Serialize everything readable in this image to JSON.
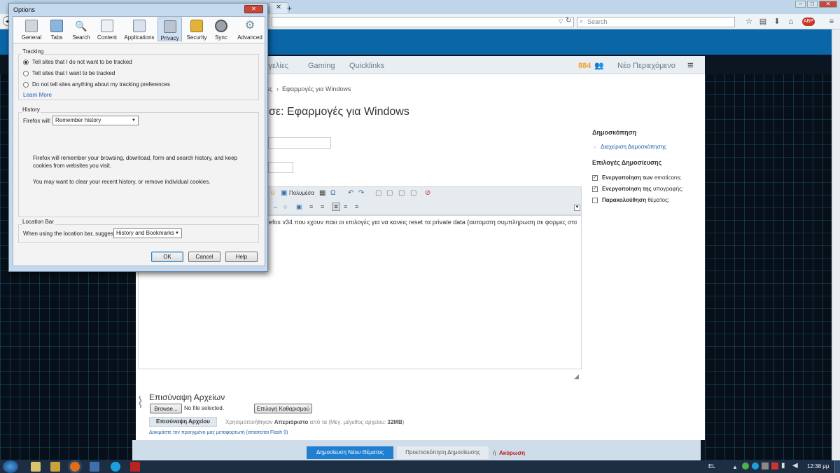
{
  "dialog": {
    "title": "Options",
    "tabs": [
      "General",
      "Tabs",
      "Search",
      "Content",
      "Applications",
      "Privacy",
      "Security",
      "Sync",
      "Advanced"
    ],
    "active_tab": "Privacy",
    "tracking": {
      "heading": "Tracking",
      "opt1": "Tell sites that I do not want to be tracked",
      "opt2": "Tell sites that I want to be tracked",
      "opt3": "Do not tell sites anything about my tracking preferences",
      "learn_more": "Learn More"
    },
    "history": {
      "heading": "History",
      "will_label": "Firefox will:",
      "select_value": "Remember history",
      "desc1": "Firefox will remember your browsing, download, form and search history, and keep cookies from websites you visit.",
      "desc2": "You may want to clear your recent history, or remove individual cookies."
    },
    "locationbar": {
      "heading": "Location Bar",
      "label": "When using the location bar, suggest:",
      "select_value": "History and Bookmarks"
    },
    "buttons": {
      "ok": "OK",
      "cancel": "Cancel",
      "help": "Help"
    }
  },
  "browser": {
    "search_placeholder": "Search"
  },
  "site": {
    "nav": [
      "γγελίες",
      "Gaming",
      "Quicklinks"
    ],
    "online_count": "884",
    "new_content": "Νέο Περιεχόμενο",
    "breadcrumb_partial": "ες",
    "breadcrumb_current": "Εφαρμογές για Windows",
    "page_title": "σε: Εφαρμογές για Windows",
    "toolbar_label": "Πολυμέσα",
    "editor_text": "efox v34 που εχουν παει οι επιλογές για να κανεις reset τα private data (αυτοματη συμπληρωση σε φορμες στο",
    "right": {
      "poll_heading": "Δημοσκόπηση",
      "poll_link": "Διαχείριση Δημοσκόπησης",
      "options_heading": "Επιλογές Δημοσίευσης",
      "opt1_bold": "Ενεργοποίηση των",
      "opt1_rest": "emoticons;",
      "opt2_bold": "Ενεργοποίηση της",
      "opt2_rest": "υπογραφής;",
      "opt3_bold": "Παρακολούθηση",
      "opt3_rest": "θέματος;"
    },
    "attach": {
      "heading": "Επισύναψη Αρχείων",
      "browse": "Browse...",
      "no_file": "No file selected.",
      "choose_clear": "Επιλογή Καθαρισμού",
      "attach_btn": "Επισύναψη Αρχείου",
      "used_text": "Χρησιμοποιήθηκαν",
      "used_bold": "Απεριόριστο",
      "used_mid": "από τα (Μεγ. μέγεθος αρχείου:",
      "used_size": "32MB",
      "used_end": ")",
      "prev_uploader": "Δοκιμάστε τον προηγμένο μας μεταφορτωτή (απαιτείται Flash 9)"
    },
    "footer": {
      "submit": "Δημοσίευση Νέου Θέματος",
      "preview": "Προεπισκόπηση Δημοσίευσης",
      "or": "ή",
      "cancel": "Ακύρωση"
    }
  },
  "taskbar": {
    "lang": "EL",
    "time": "12:38 μμ"
  },
  "colors": {
    "accent": "#0a66a7",
    "submit": "#1f7fd1",
    "cancel": "#c01818",
    "orange": "#f0a030"
  }
}
